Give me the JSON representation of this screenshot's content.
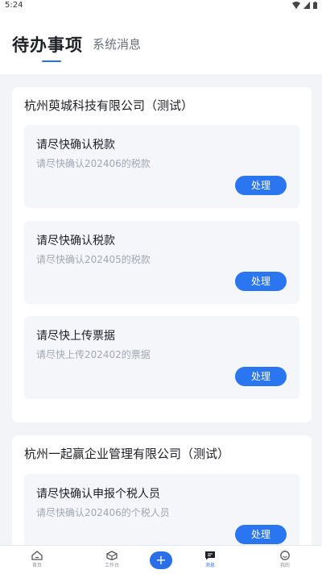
{
  "status": {
    "time": "5:24"
  },
  "header": {
    "tab_active": "待办事项",
    "tab_inactive": "系统消息"
  },
  "companies": [
    {
      "name": "杭州萸城科技有限公司（测试）",
      "tasks": [
        {
          "title": "请尽快确认税款",
          "desc": "请尽快确认202406的税款",
          "action": "处理"
        },
        {
          "title": "请尽快确认税款",
          "desc": "请尽快确认202405的税款",
          "action": "处理"
        },
        {
          "title": "请尽快上传票据",
          "desc": "请尽快上传202402的票据",
          "action": "处理"
        }
      ]
    },
    {
      "name": "杭州一起赢企业管理有限公司（测试）",
      "tasks": [
        {
          "title": "请尽快确认申报个税人员",
          "desc": "请尽快确认202406的个税人员",
          "action": "处理"
        }
      ]
    }
  ],
  "tabbar": {
    "items": [
      "首页",
      "工作台",
      "消息",
      "我的"
    ],
    "active": "消息",
    "plus": "+"
  },
  "colors": {
    "accent": "#2a6ee8",
    "background": "#f3f4f8"
  }
}
